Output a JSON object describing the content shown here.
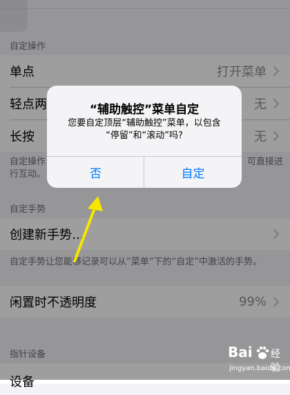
{
  "sections": {
    "custom_actions": {
      "header": "自定操作",
      "rows": [
        {
          "label": "单点",
          "value": "打开菜单"
        },
        {
          "label": "轻点两",
          "value": "无"
        },
        {
          "label": "长按",
          "value": "无"
        }
      ],
      "footer_left": "自定操作",
      "footer_line2_left": "行互动。",
      "footer_right": "可直接进"
    },
    "custom_gestures": {
      "header": "自定手势",
      "rows": [
        {
          "label": "创建新手势…",
          "value": ""
        }
      ],
      "footer": "自定手势让您能够记录可以从“菜单”下的“自定”中激活的手势。"
    },
    "idle_opacity": {
      "rows": [
        {
          "label": "闲置时不透明度",
          "value": "99%"
        }
      ]
    },
    "pointer_devices": {
      "header": "指针设备",
      "rows": [
        {
          "label": "设备",
          "value": ""
        }
      ]
    }
  },
  "alert": {
    "title": "“辅助触控”菜单自定",
    "message_line1": "您要自定顶层“辅助触控”菜单，以包含",
    "message_line2": "“停留”和“滚动”吗?",
    "buttons": {
      "no": "否",
      "customize": "自定"
    }
  },
  "watermark": {
    "brand": "Bai",
    "brand_cn": "经验",
    "url": "jingyan.baidu.com"
  },
  "colors": {
    "ios_blue": "#007aff",
    "arrow_yellow": "#f7e600",
    "background": "#f2f2f7",
    "secondary_text": "#8e8e93"
  },
  "icons": {
    "chevron": "chevron-right-icon",
    "arrow": "annotation-arrow",
    "paw": "baidu-paw-icon"
  }
}
